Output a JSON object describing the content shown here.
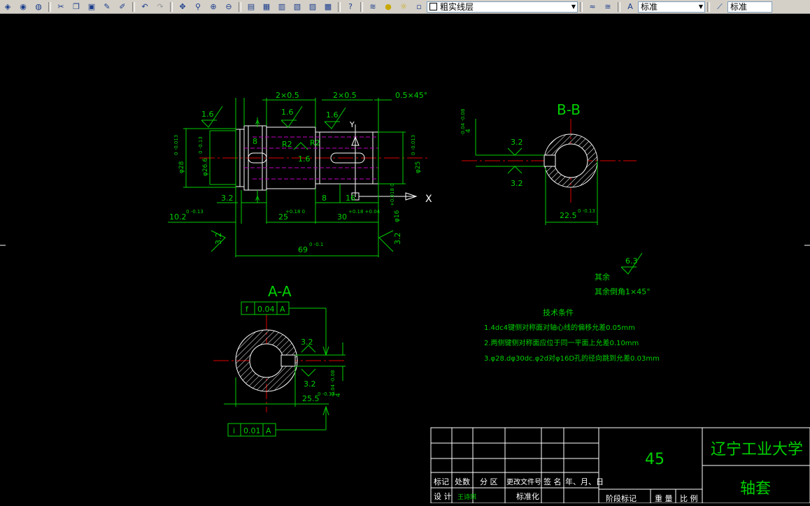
{
  "toolbar": {
    "layer_name": "粗实线层",
    "text_style": "标准",
    "dim_style": "标准"
  },
  "drawing": {
    "dims_main": {
      "chamfer1": "2×0.5",
      "chamfer2": "2×0.5",
      "chamfer_edge": "0.5×45°",
      "rough1": "1.6",
      "rough2": "1.6",
      "rough3": "1.6",
      "rough4": "1.6",
      "r2a": "R2",
      "r2b": "R2",
      "dia28": "φ28",
      "dia28_tol": "0 -0.013",
      "dia26": "φ26.6",
      "dia26_tol": "0 -0.13",
      "dia25": "φ25",
      "dia25_tol": "0 -0.013",
      "dia16": "φ16",
      "dia16_tol": "+0.018 0",
      "len32": "3.2",
      "len8a": "8",
      "len8b": "8",
      "len16": "16",
      "len25": "25",
      "len25_tol": "+0.18 0",
      "len30": "30",
      "len30_tol": "+0.18 +0.04",
      "len10": "10.2",
      "len10_tol": "0 -0.13",
      "len69": "69",
      "len69_tol": "0 -0.1",
      "rough_left": "3.2",
      "rough_right": "3.2",
      "axis_y": "Y",
      "axis_x": "X",
      "section_a": "A"
    },
    "view_bb": {
      "title": "B-B",
      "rough_top": "3.2",
      "rough_bot": "3.2",
      "key_w": "4",
      "key_tol": "-0.04 -0.08",
      "dim": "22.5",
      "dim_tol": "0 -0.13"
    },
    "view_aa": {
      "title": "A-A",
      "tol1_sym": "f",
      "tol1_val": "0.04",
      "tol1_ref": "A",
      "tol2_sym": "i",
      "tol2_val": "0.01",
      "tol2_ref": "A",
      "rough_top": "3.2",
      "rough_bot": "3.2",
      "key_w": "4",
      "key_tol": "-0.04 -0.08",
      "dim": "25.5",
      "dim_tol": "0 -0.13"
    },
    "notes": {
      "rough_val": "6.3",
      "rest": "其余",
      "rest_chamfer": "其余倒角1×45°",
      "title": "技术条件",
      "line1": "1.4dc4键侧对称面对轴心线的偏移允差0.05mm",
      "line2": "2.两侧键侧对称面应位于同一平面上允差0.10mm",
      "line3": "3.φ28.dφ30dc.φ2d对φ16D孔的径向跳到允差0.03mm"
    },
    "title_block": {
      "material": "45",
      "school": "辽宁工业大学",
      "part_name": "轴套",
      "h_mark": "标记",
      "h_count": "处数",
      "h_zone": "分 区",
      "h_doc": "更改文件号",
      "h_sign": "签 名",
      "h_date": "年、月、日",
      "h_design": "设 计",
      "designer": "王诗琪",
      "h_std": "标准化",
      "h_stage": "阶段标记",
      "h_weight": "重 量",
      "h_scale": "比 例"
    }
  }
}
